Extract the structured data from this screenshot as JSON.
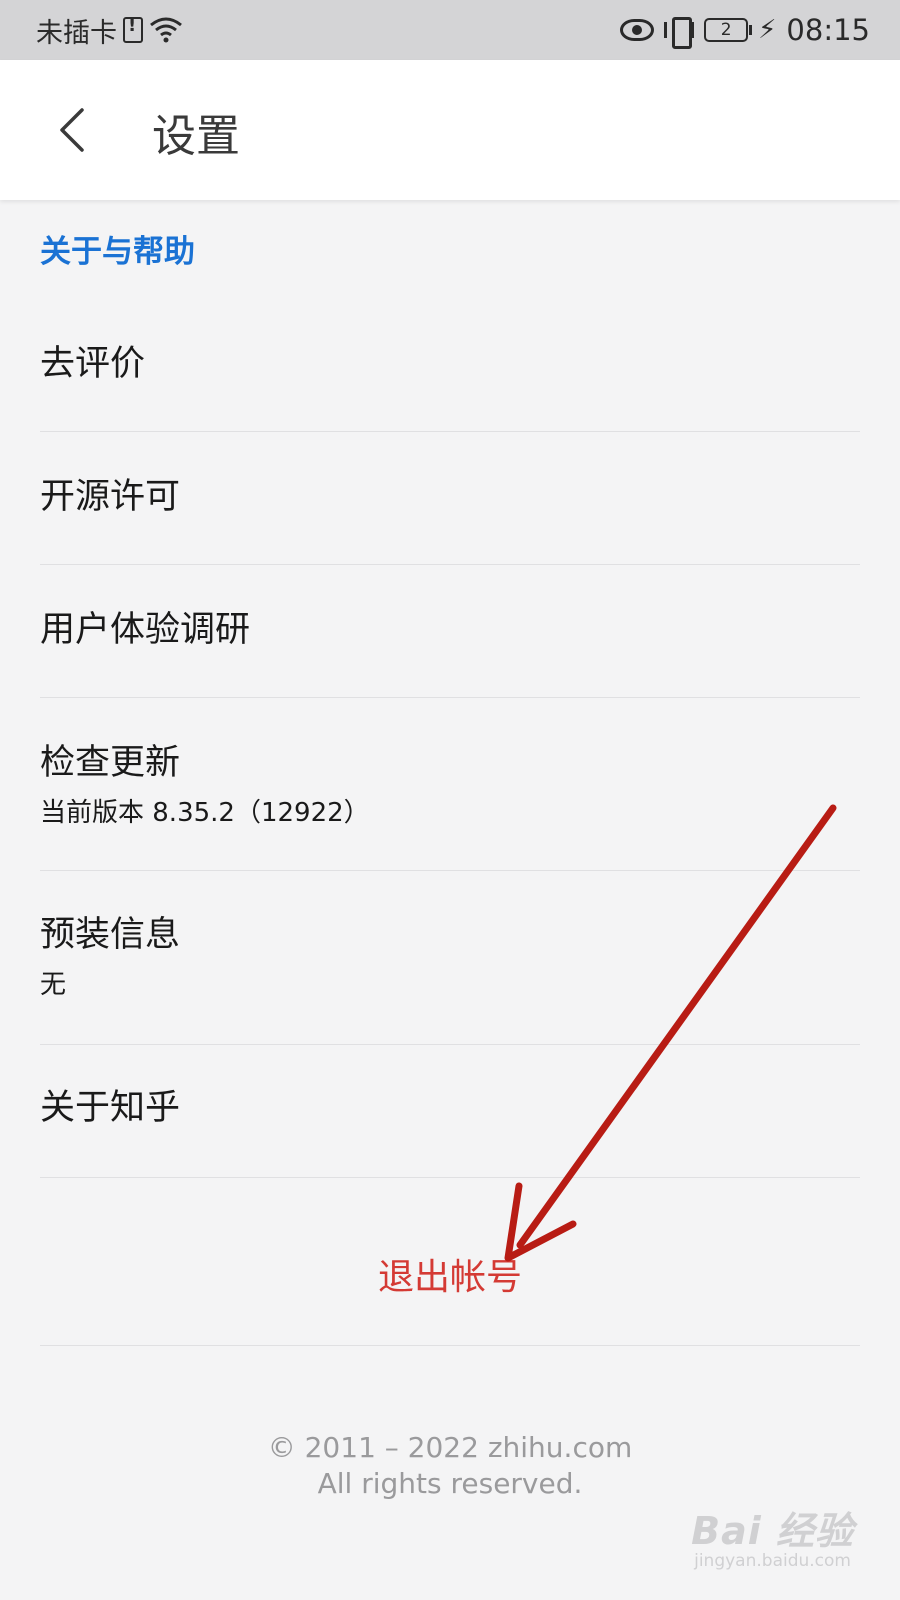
{
  "status_bar": {
    "carrier": "未插卡",
    "battery_level": "2",
    "time": "08:15"
  },
  "header": {
    "title": "设置",
    "back_icon": "chevron-left-icon"
  },
  "section": {
    "title": "关于与帮助",
    "title_color": "#1a72d4"
  },
  "rows": [
    {
      "label": "去评价"
    },
    {
      "label": "开源许可"
    },
    {
      "label": "用户体验调研"
    },
    {
      "label": "检查更新",
      "sublabel": "当前版本 8.35.2（12922）"
    },
    {
      "label": "预装信息",
      "sublabel": "无"
    },
    {
      "label": "关于知乎"
    }
  ],
  "logout": {
    "label": "退出帐号",
    "color": "#d43a34"
  },
  "footer": {
    "copyright": "© 2011 – 2022 zhihu.com",
    "rights": "All rights reserved."
  },
  "watermark": {
    "logo": "Bai 经验",
    "url": "jingyan.baidu.com"
  },
  "annotation": {
    "icon": "red-arrow-annotation",
    "color": "#b81c14"
  }
}
